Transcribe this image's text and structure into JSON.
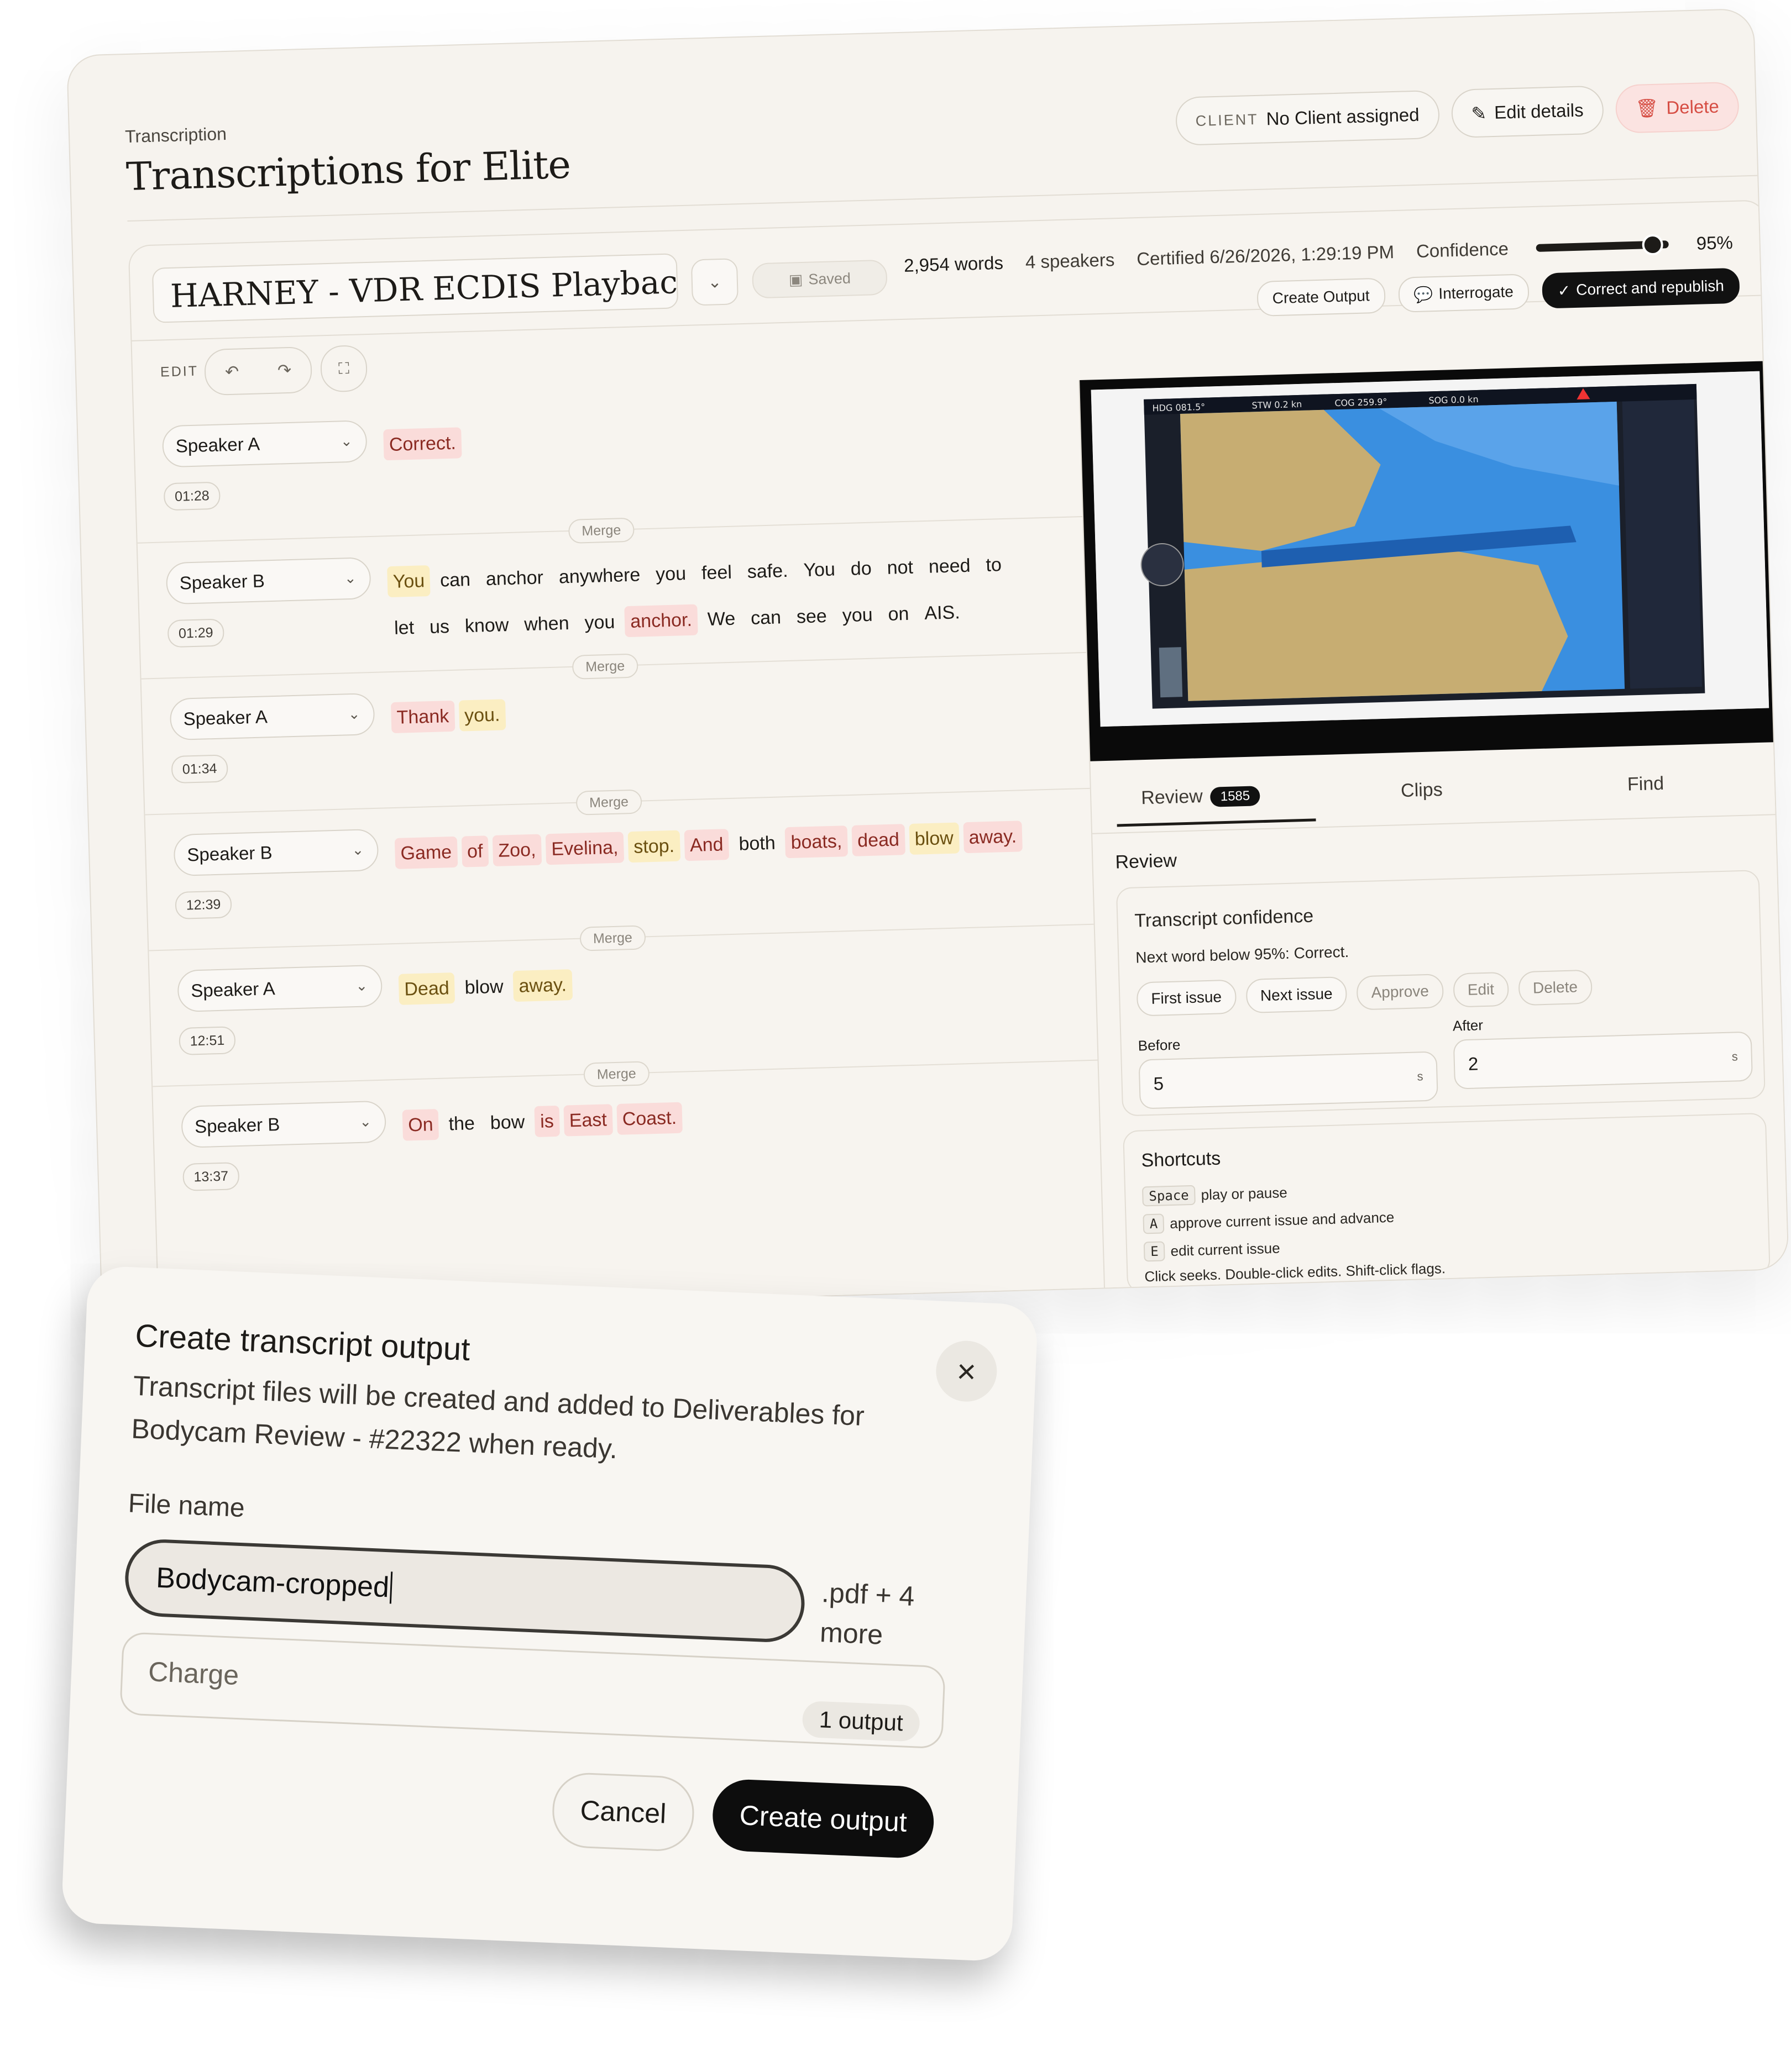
{
  "header": {
    "breadcrumb": "Transcription",
    "title": "Transcriptions for Elite",
    "client_label": "CLIENT",
    "client_value": "No Client assigned",
    "edit_details": "Edit details",
    "delete": "Delete"
  },
  "toolbar": {
    "file_name": "HARNEY - VDR ECDIS Playback [as",
    "saved": "Saved",
    "words": "2,954 words",
    "speakers": "4 speakers",
    "certified": "Certified 6/26/2026, 1:29:19 PM",
    "confidence_label": "Confidence",
    "confidence_value": "95%",
    "edit_label": "EDIT",
    "create_output": "Create Output",
    "interrogate": "Interrogate",
    "correct_republish": "Correct and republish"
  },
  "merge_label": "Merge",
  "segments": [
    {
      "speaker": "Speaker A",
      "time": "01:28",
      "words": [
        {
          "t": "Correct.",
          "c": "r"
        }
      ]
    },
    {
      "speaker": "Speaker B",
      "time": "01:29",
      "words": [
        {
          "t": "You",
          "c": "y"
        },
        {
          "t": "can",
          "c": "n"
        },
        {
          "t": "anchor",
          "c": "n"
        },
        {
          "t": "anywhere",
          "c": "n"
        },
        {
          "t": "you",
          "c": "n"
        },
        {
          "t": "feel",
          "c": "n"
        },
        {
          "t": "safe.",
          "c": "n"
        },
        {
          "t": "You",
          "c": "n"
        },
        {
          "t": "do",
          "c": "n"
        },
        {
          "t": "not",
          "c": "n"
        },
        {
          "t": "need",
          "c": "n"
        },
        {
          "t": "to",
          "c": "n"
        },
        {
          "t": "let",
          "c": "n"
        },
        {
          "t": "us",
          "c": "n"
        },
        {
          "t": "know",
          "c": "n"
        },
        {
          "t": "when",
          "c": "n"
        },
        {
          "t": "you",
          "c": "n"
        },
        {
          "t": "anchor.",
          "c": "r"
        },
        {
          "t": "We",
          "c": "n"
        },
        {
          "t": "can",
          "c": "n"
        },
        {
          "t": "see",
          "c": "n"
        },
        {
          "t": "you",
          "c": "n"
        },
        {
          "t": "on",
          "c": "n"
        },
        {
          "t": "AIS.",
          "c": "n"
        }
      ]
    },
    {
      "speaker": "Speaker A",
      "time": "01:34",
      "words": [
        {
          "t": "Thank",
          "c": "r"
        },
        {
          "t": "you.",
          "c": "y"
        }
      ]
    },
    {
      "speaker": "Speaker B",
      "time": "12:39",
      "words": [
        {
          "t": "Game",
          "c": "r"
        },
        {
          "t": "of",
          "c": "r"
        },
        {
          "t": "Zoo,",
          "c": "r"
        },
        {
          "t": "Evelina,",
          "c": "r"
        },
        {
          "t": "stop.",
          "c": "y"
        },
        {
          "t": "And",
          "c": "r"
        },
        {
          "t": "both",
          "c": "n"
        },
        {
          "t": "boats,",
          "c": "r"
        },
        {
          "t": "dead",
          "c": "r"
        },
        {
          "t": "blow",
          "c": "y"
        },
        {
          "t": "away.",
          "c": "r"
        }
      ]
    },
    {
      "speaker": "Speaker A",
      "time": "12:51",
      "words": [
        {
          "t": "Dead",
          "c": "y"
        },
        {
          "t": "blow",
          "c": "n"
        },
        {
          "t": "away.",
          "c": "y"
        }
      ]
    },
    {
      "speaker": "Speaker B",
      "time": "13:37",
      "words": [
        {
          "t": "On",
          "c": "r"
        },
        {
          "t": "the",
          "c": "n"
        },
        {
          "t": "bow",
          "c": "n"
        },
        {
          "t": "is",
          "c": "r"
        },
        {
          "t": "East",
          "c": "r"
        },
        {
          "t": "Coast.",
          "c": "r"
        }
      ]
    }
  ],
  "video": {
    "hdg": "HDG 081.5°",
    "stw": "STW 0.2 kn",
    "cog": "COG 259.9°",
    "sog": "SOG 0.0 kn"
  },
  "tabs": {
    "review": "Review",
    "review_count": "1585",
    "clips": "Clips",
    "find": "Find"
  },
  "review": {
    "heading": "Review",
    "tc_title": "Transcript confidence",
    "tc_sub": "Next word below 95%: Correct.",
    "first_issue": "First issue",
    "next_issue": "Next issue",
    "approve": "Approve",
    "edit": "Edit",
    "delete": "Delete",
    "before_label": "Before",
    "before_value": "5",
    "after_label": "After",
    "after_value": "2",
    "unit": "s"
  },
  "shortcuts": {
    "title": "Shortcuts",
    "items": [
      {
        "key": "Space",
        "desc": "play or pause"
      },
      {
        "key": "A",
        "desc": "approve current issue and advance"
      },
      {
        "key": "E",
        "desc": "edit current issue"
      }
    ],
    "note": "Click seeks. Double-click edits. Shift-click flags."
  },
  "dialog": {
    "title": "Create transcript output",
    "description": "Transcript files will be created and added to Deliverables for Bodycam Review - #22322 when ready.",
    "file_label": "File name",
    "file_value": "Bodycam-cropped",
    "file_ext": ".pdf + 4 more",
    "charge_label": "Charge",
    "charge_badge": "1 output",
    "cancel": "Cancel",
    "create": "Create output"
  }
}
